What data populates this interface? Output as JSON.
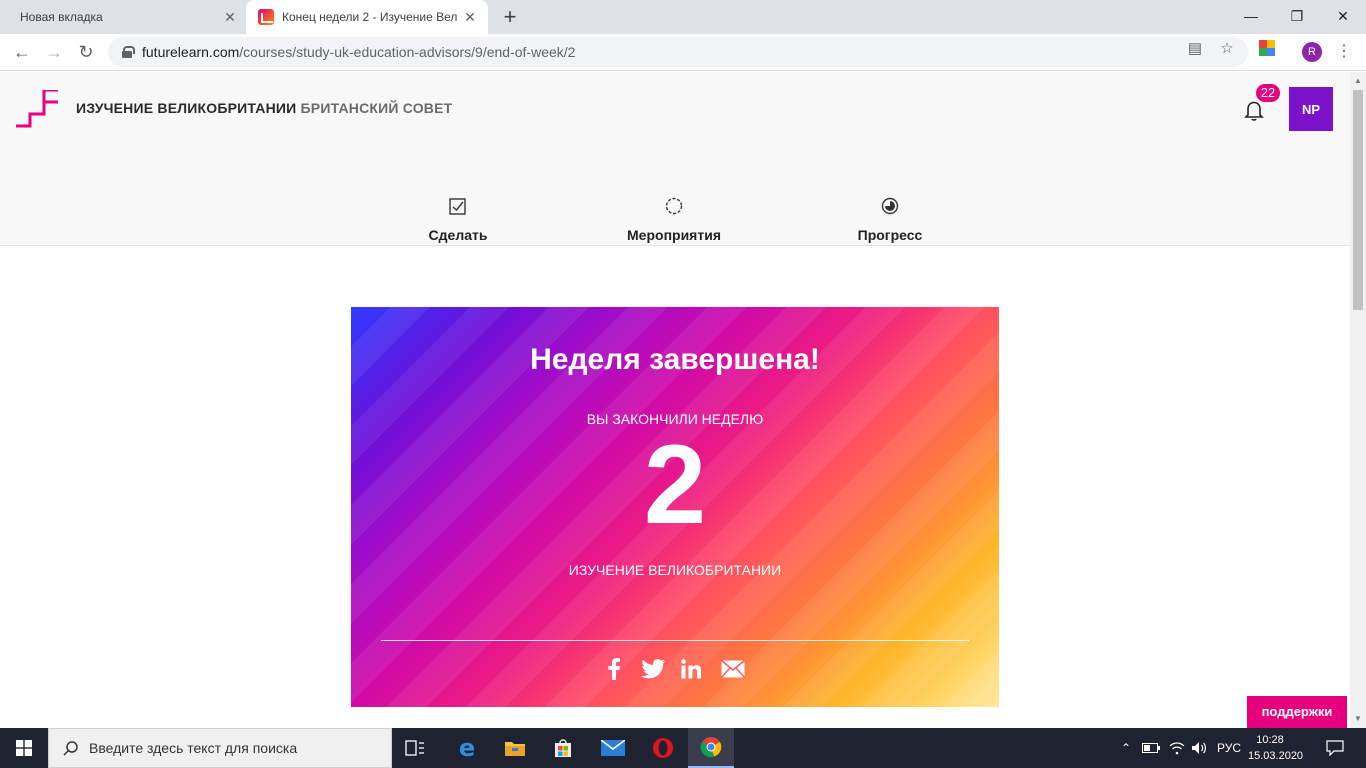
{
  "browser": {
    "tabs": [
      {
        "title": "Новая вкладка",
        "active": false
      },
      {
        "title": "Конец недели 2 - Изучение Вел",
        "active": true
      }
    ],
    "new_tab_icon": "plus-icon",
    "url": {
      "domain": "futurelearn.com",
      "path": "/courses/study-uk-education-advisors/9/end-of-week/2"
    },
    "profile_initial": "R"
  },
  "site": {
    "course_title": "ИЗУЧЕНИЕ ВЕЛИКОБРИТАНИИ",
    "course_org": "БРИТАНСКИЙ СОВЕТ",
    "notification_count": "22",
    "user_initials": "NP",
    "nav": [
      {
        "label": "Сделать",
        "icon": "checkbox-icon"
      },
      {
        "label": "Мероприятия",
        "icon": "activity-circle-icon"
      },
      {
        "label": "Прогресс",
        "icon": "progress-icon"
      }
    ],
    "accent_color": "#e6007e"
  },
  "hero": {
    "title": "Неделя завершена!",
    "subtitle": "ВЫ ЗАКОНЧИЛИ НЕДЕЛЮ",
    "week_number": "2",
    "course_name": "ИЗУЧЕНИЕ ВЕЛИКОБРИТАНИИ",
    "share_icons": [
      "facebook-icon",
      "twitter-icon",
      "linkedin-icon",
      "email-icon"
    ]
  },
  "support_button": "поддержки",
  "taskbar": {
    "search_placeholder": "Введите здесь текст для поиска",
    "language": "РУС",
    "time": "10:28",
    "date": "15.03.2020"
  }
}
